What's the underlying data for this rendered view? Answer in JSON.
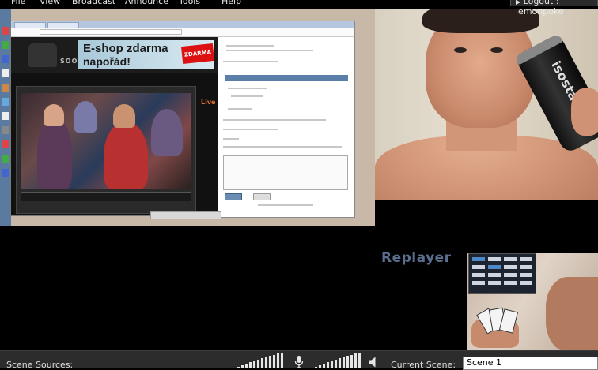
{
  "menubar": {
    "items": [
      "File",
      "View",
      "Broadcast",
      "Announce",
      "Tools",
      "Help"
    ],
    "logout_label": "Logout : lemonpoke"
  },
  "desktop_capture": {
    "banner_line1": "E-shop zdarma",
    "banner_line2": "napořád!",
    "banner_tag": "ZDARMA",
    "site_word": "SOON",
    "live_label": "Live"
  },
  "webcam": {
    "can_text": "isostar"
  },
  "replayer": {
    "label": "Replayer"
  },
  "bottombar": {
    "scene_sources_label": "Scene Sources:",
    "current_scene_label": "Current Scene:",
    "current_scene_value": "Scene 1",
    "mic_icon": "microphone-icon",
    "speaker_icon": "speaker-icon"
  },
  "colors": {
    "background": "#000000",
    "menubar": "#000000",
    "bottombar": "#2c2c2c",
    "replayer_text": "#5a6e90",
    "banner_tag": "#dd1111"
  }
}
